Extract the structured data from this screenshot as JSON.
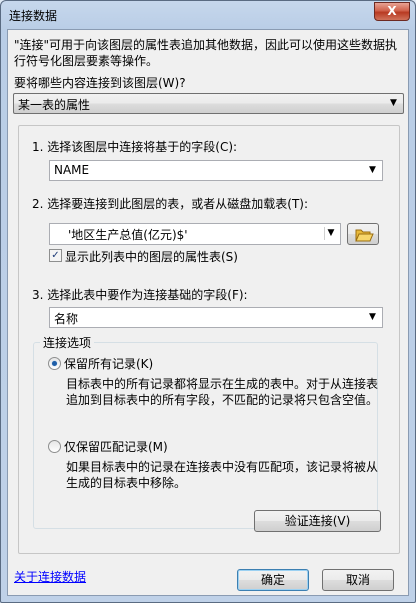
{
  "window": {
    "title": "连接数据",
    "close_label": "X"
  },
  "intro": {
    "line1": "\"连接\"可用于向该图层的属性表追加其他数据，因此可以使用这些数据执",
    "line2": "行符号化图层要素等操作。"
  },
  "join_what": {
    "label": "要将哪些内容连接到该图层(W)?",
    "selected": "某一表的属性"
  },
  "step1": {
    "label": "1. 选择该图层中连接将基于的字段(C):",
    "selected": "NAME"
  },
  "step2": {
    "label": "2. 选择要连接到此图层的表，或者从磁盘加载表(T):",
    "selected": "'地区生产总值(亿元)$'",
    "checkbox_label": "显示此列表中的图层的属性表(S)",
    "checkbox_checked": true
  },
  "step3": {
    "label": "3. 选择此表中要作为连接基础的字段(F):",
    "selected": "名称"
  },
  "join_options": {
    "legend": "连接选项",
    "keep_all": {
      "label": "保留所有记录(K)",
      "desc1": "目标表中的所有记录都将显示在生成的表中。对于从连接表",
      "desc2": "追加到目标表中的所有字段，不匹配的记录将只包含空值。",
      "checked": true
    },
    "keep_matching": {
      "label": "仅保留匹配记录(M)",
      "desc1": "如果目标表中的记录在连接表中没有匹配项，该记录将被从",
      "desc2": "生成的目标表中移除。",
      "checked": false
    }
  },
  "validate_button": "验证连接(V)",
  "about_link": "关于连接数据",
  "ok_button": "确定",
  "cancel_button": "取消"
}
